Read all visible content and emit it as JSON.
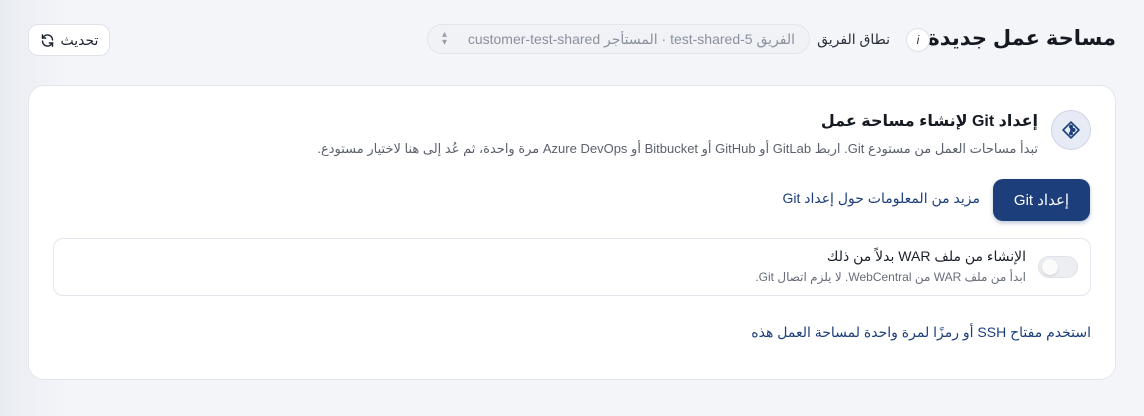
{
  "header": {
    "title": "مساحة عمل جديدة",
    "info_icon": "i",
    "scope_label": "نطاق الفريق",
    "scope_value": "الفريق test-shared-5 · المستأجر customer-test-shared",
    "refresh_label": "تحديث"
  },
  "setup": {
    "title": "إعداد Git لإنشاء مساحة عمل",
    "description": "تبدأ مساحات العمل من مستودع Git. اربط GitLab أو GitHub أو Bitbucket أو Azure DevOps مرة واحدة، ثم عُد إلى هنا لاختيار مستودع.",
    "primary_button": "إعداد Git",
    "learn_more": "مزيد من المعلومات حول إعداد Git"
  },
  "war": {
    "title": "الإنشاء من ملف WAR بدلاً من ذلك",
    "description": "ابدأ من ملف WAR من WebCentral. لا يلزم اتصال Git.",
    "toggle_on": false
  },
  "ssh_link": "استخدم مفتاح SSH أو رمزًا لمرة واحدة لمساحة العمل هذه",
  "colors": {
    "accent": "#1c3f7c",
    "background": "#f3f5f9"
  }
}
